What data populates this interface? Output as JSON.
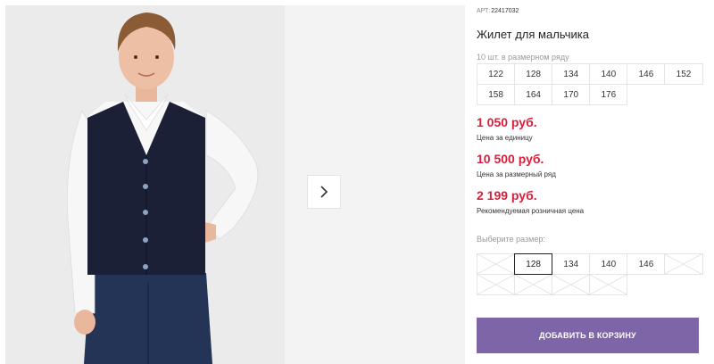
{
  "product": {
    "art_prefix": "АРТ:",
    "art_number": "22417032",
    "title": "Жилет для мальчика",
    "image_alt": "boy-in-navy-vest-photo"
  },
  "pack": {
    "note": "10 шт. в размерном ряду",
    "sizes": [
      "122",
      "128",
      "134",
      "140",
      "146",
      "152",
      "158",
      "164",
      "170",
      "176"
    ]
  },
  "prices": [
    {
      "value": "1 050 руб.",
      "label": "Цена за единицу"
    },
    {
      "value": "10 500 руб.",
      "label": "Цена за размерный ряд"
    },
    {
      "value": "2 199 руб.",
      "label": "Рекомендуемая розничная цена"
    }
  ],
  "size_select": {
    "label": "Выберите размер:",
    "options": [
      {
        "label": "",
        "state": "disabled"
      },
      {
        "label": "128",
        "state": "selected"
      },
      {
        "label": "134",
        "state": "available"
      },
      {
        "label": "140",
        "state": "available"
      },
      {
        "label": "146",
        "state": "available"
      },
      {
        "label": "",
        "state": "disabled"
      },
      {
        "label": "",
        "state": "disabled"
      },
      {
        "label": "",
        "state": "disabled"
      },
      {
        "label": "",
        "state": "disabled"
      },
      {
        "label": "",
        "state": "disabled"
      }
    ]
  },
  "cart_button": {
    "label": "ДОБАВИТЬ В КОРЗИНУ"
  },
  "colors": {
    "price": "#d81e3a",
    "button": "#7e65a8",
    "photo_background": "#ebebeb",
    "vest": "#1b2036",
    "trousers": "#243457"
  },
  "icons": {
    "next": "chevron-right-icon",
    "disabled_size": "cross-icon"
  }
}
